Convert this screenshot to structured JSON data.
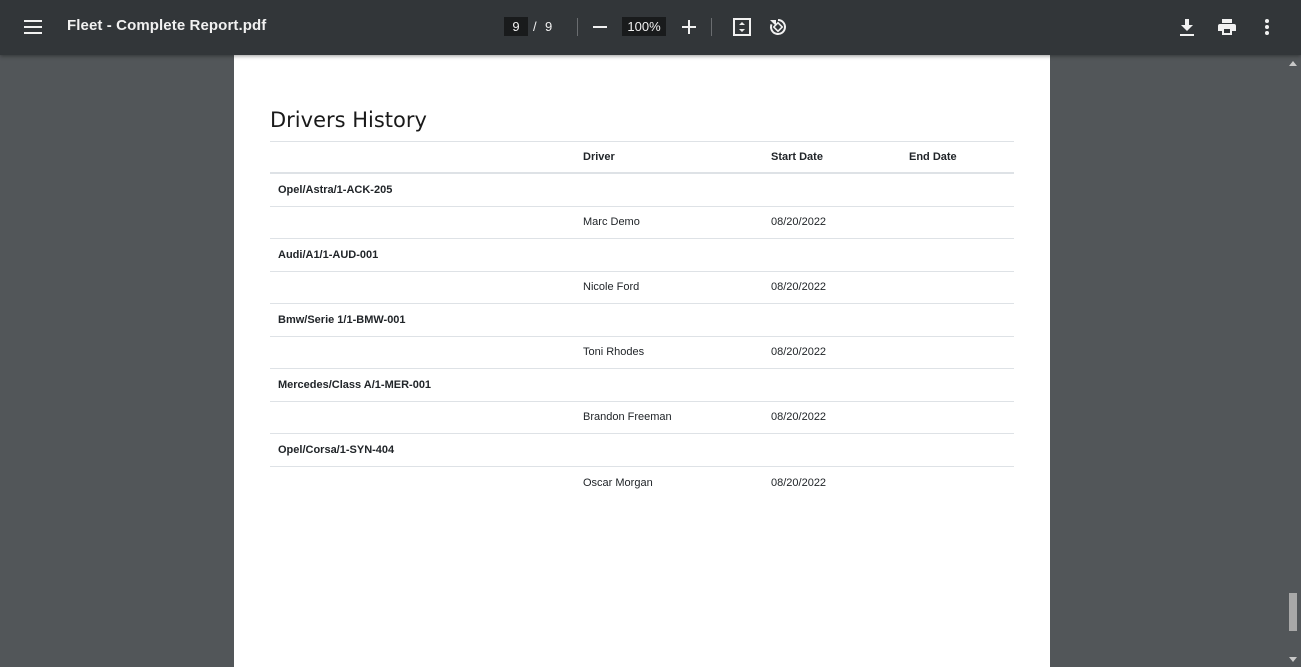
{
  "toolbar": {
    "title": "Fleet - Complete Report.pdf",
    "page_current": "9",
    "page_separator": "/",
    "page_total": "9",
    "zoom": "100%",
    "icons": {
      "menu": "menu-icon",
      "zoom_out": "minus-icon",
      "zoom_in": "plus-icon",
      "fit": "fit-page-icon",
      "rotate": "rotate-icon",
      "download": "download-icon",
      "print": "print-icon",
      "more": "more-vert-icon"
    }
  },
  "report": {
    "title": "Drivers History",
    "columns": {
      "vehicle": "",
      "driver": "Driver",
      "start": "Start Date",
      "end": "End Date"
    },
    "groups": [
      {
        "vehicle": "Opel/Astra/1-ACK-205",
        "driver": "Marc Demo",
        "start": "08/20/2022",
        "end": ""
      },
      {
        "vehicle": "Audi/A1/1-AUD-001",
        "driver": "Nicole Ford",
        "start": "08/20/2022",
        "end": ""
      },
      {
        "vehicle": "Bmw/Serie 1/1-BMW-001",
        "driver": "Toni Rhodes",
        "start": "08/20/2022",
        "end": ""
      },
      {
        "vehicle": "Mercedes/Class A/1-MER-001",
        "driver": "Brandon Freeman",
        "start": "08/20/2022",
        "end": ""
      },
      {
        "vehicle": "Opel/Corsa/1-SYN-404",
        "driver": "Oscar Morgan",
        "start": "08/20/2022",
        "end": ""
      }
    ]
  },
  "colors": {
    "toolbar_bg": "#323639",
    "viewer_bg": "#525659",
    "page_bg": "#ffffff"
  }
}
